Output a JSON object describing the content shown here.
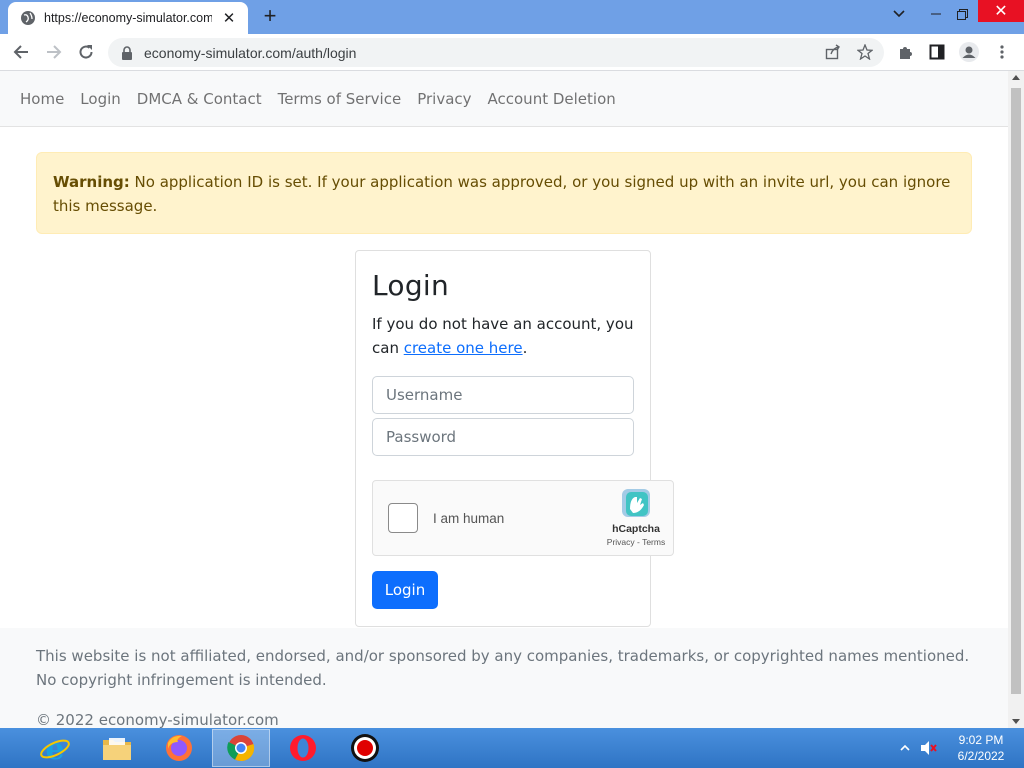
{
  "browser": {
    "tab_title": "https://economy-simulator.com/",
    "url": "economy-simulator.com/auth/login"
  },
  "nav": {
    "items": [
      {
        "label": "Home"
      },
      {
        "label": "Login"
      },
      {
        "label": "DMCA & Contact"
      },
      {
        "label": "Terms of Service"
      },
      {
        "label": "Privacy"
      },
      {
        "label": "Account Deletion"
      }
    ]
  },
  "alert": {
    "title": "Warning:",
    "message": " No application ID is set. If your application was approved, or you signed up with an invite url, you can ignore this message."
  },
  "login": {
    "heading": "Login",
    "intro": "If you do not have an account, you can ",
    "link_text": "create one here",
    "intro_end": ".",
    "username_placeholder": "Username",
    "password_placeholder": "Password",
    "captcha_label": "I am human",
    "captcha_brand": "hCaptcha",
    "captcha_links": "Privacy - Terms",
    "button_label": "Login"
  },
  "footer": {
    "disclaimer": "This website is not affiliated, endorsed, and/or sponsored by any companies, trademarks, or copyrighted names mentioned. No copyright infringement is intended.",
    "copyright": "© 2022 economy-simulator.com"
  },
  "taskbar": {
    "time": "9:02 PM",
    "date": "6/2/2022",
    "apps": [
      "internet-explorer-icon",
      "file-explorer-icon",
      "firefox-icon",
      "chrome-icon",
      "opera-icon",
      "recorder-icon"
    ]
  },
  "colors": {
    "primary": "#0d6efd",
    "warning_bg": "#fff3cd",
    "warning_text": "#664d03",
    "tabbar": "#6fa0e6",
    "close_red": "#e81123"
  }
}
